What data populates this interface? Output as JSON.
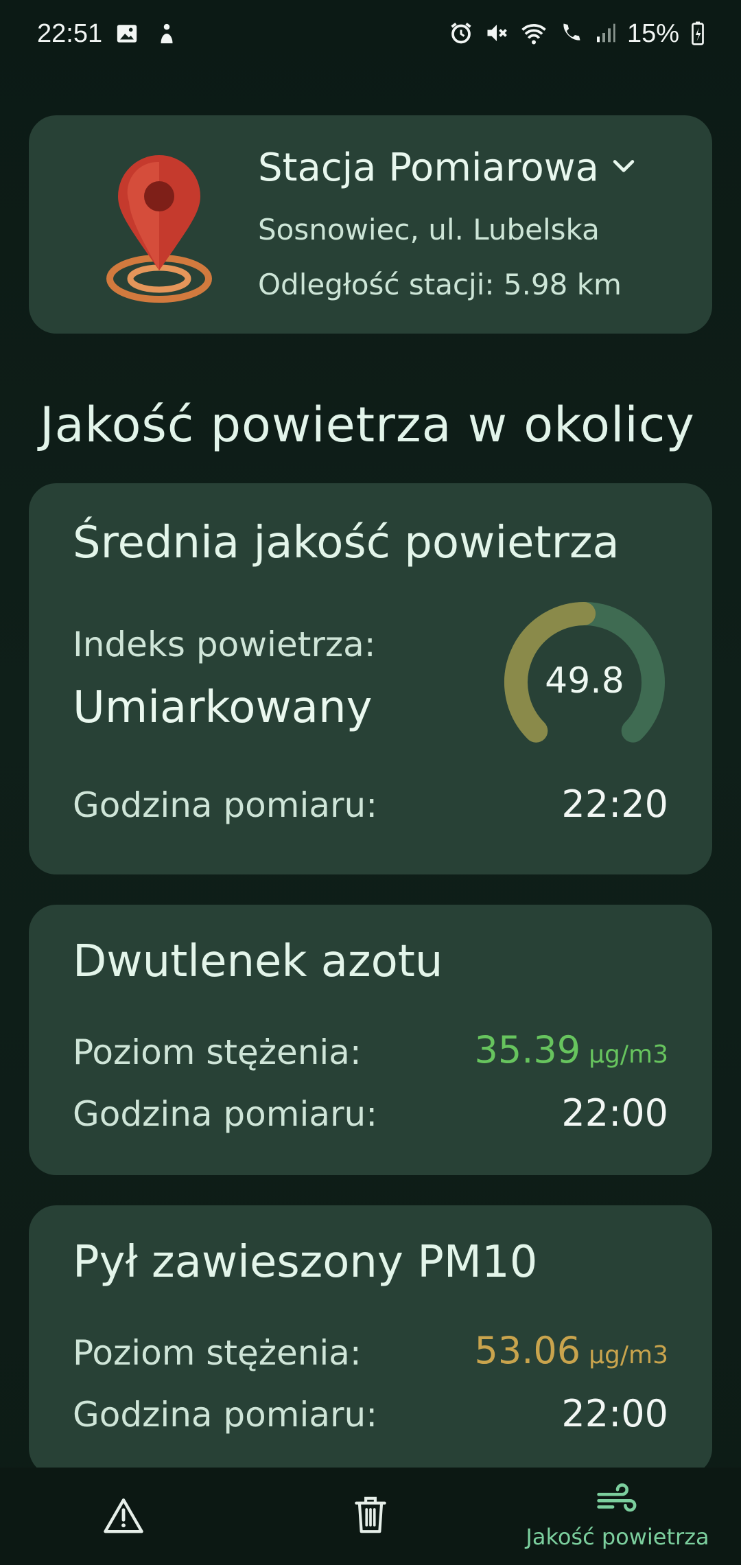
{
  "status_bar": {
    "time": "22:51",
    "battery": "15%"
  },
  "station": {
    "title": "Stacja Pomiarowa",
    "address": "Sosnowiec, ul. Lubelska",
    "distance": "Odległość stacji: 5.98 km"
  },
  "section_title": "Jakość powietrza w okolicy",
  "aq_card": {
    "title": "Średnia jakość powietrza",
    "index_label": "Indeks powietrza:",
    "index_value": "Umiarkowany",
    "gauge_value": "49.8",
    "gauge_fraction": 0.498,
    "time_label": "Godzina pomiaru:",
    "time_value": "22:20",
    "colors": {
      "gauge_fill": "#8a8a4a",
      "gauge_track": "#3f6b52"
    }
  },
  "no2_card": {
    "title": "Dwutlenek azotu",
    "conc_label": "Poziom stężenia:",
    "conc_value": "35.39",
    "conc_unit": "µg/m3",
    "time_label": "Godzina pomiaru:",
    "time_value": "22:00",
    "colors": {
      "value": "#67c45e"
    }
  },
  "pm10_card": {
    "title": "Pył zawieszony PM10",
    "conc_label": "Poziom stężenia:",
    "conc_value": "53.06",
    "conc_unit": "µg/m3",
    "time_label": "Godzina pomiaru:",
    "time_value": "22:00",
    "colors": {
      "value": "#c9a44d"
    }
  },
  "bottom_nav": {
    "items": [
      {
        "icon": "alert-triangle-icon"
      },
      {
        "icon": "trash-icon"
      },
      {
        "icon": "wind-icon",
        "label": "Jakość powietrza"
      }
    ],
    "active_color": "#7ccf9e"
  }
}
